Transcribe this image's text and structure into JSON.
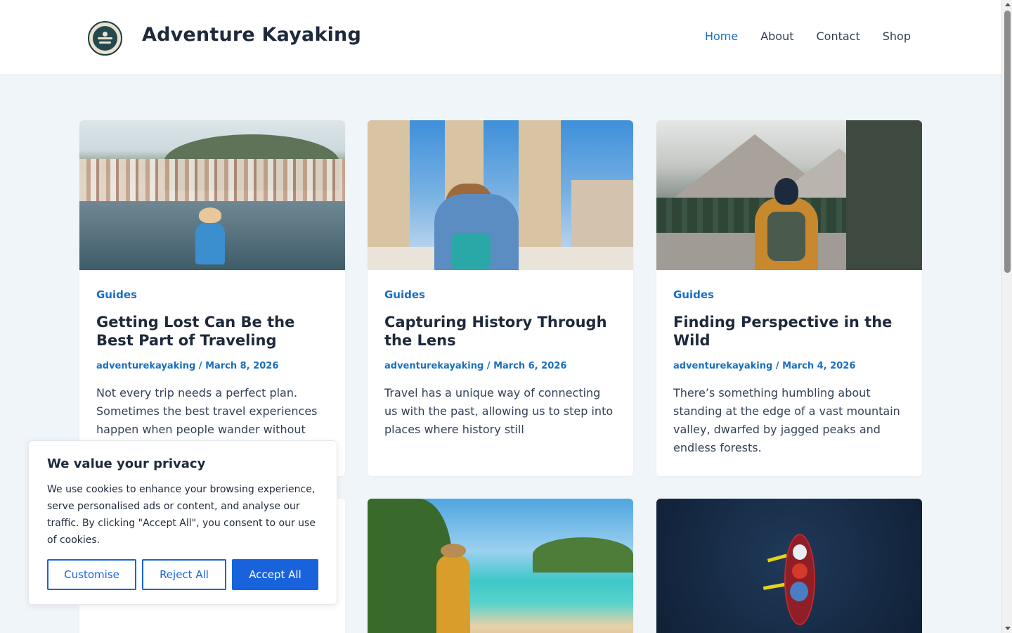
{
  "header": {
    "site_title": "Adventure Kayaking",
    "logo_icon": "kayak-compass-logo",
    "nav": [
      {
        "label": "Home",
        "active": true
      },
      {
        "label": "About",
        "active": false
      },
      {
        "label": "Contact",
        "active": false
      },
      {
        "label": "Shop",
        "active": false
      }
    ]
  },
  "posts": [
    {
      "category": "Guides",
      "title": "Getting Lost Can Be the Best Part of Traveling",
      "author": "adventurekayaking",
      "date": "March 8, 2026",
      "excerpt": "Not every trip needs a perfect plan. Sometimes the best travel experiences happen when people wander without"
    },
    {
      "category": "Guides",
      "title": "Capturing History Through the Lens",
      "author": "adventurekayaking",
      "date": "March 6, 2026",
      "excerpt": "Travel has a unique way of connecting us with the past, allowing us to step into places where history still"
    },
    {
      "category": "Guides",
      "title": "Finding Perspective in the Wild",
      "author": "adventurekayaking",
      "date": "March 4, 2026",
      "excerpt": "There’s something humbling about standing at the edge of a vast mountain valley, dwarfed by jagged peaks and endless forests."
    }
  ],
  "cookie": {
    "heading": "We value your privacy",
    "text": "We use cookies to enhance your browsing experience, serve personalised ads or content, and analyse our traffic. By clicking \"Accept All\", you consent to our use of cookies.",
    "customise_label": "Customise",
    "reject_label": "Reject All",
    "accept_label": "Accept All"
  },
  "colors": {
    "accent": "#1a6fc0",
    "button": "#1863dc",
    "page_bg": "#f0f5fa"
  }
}
